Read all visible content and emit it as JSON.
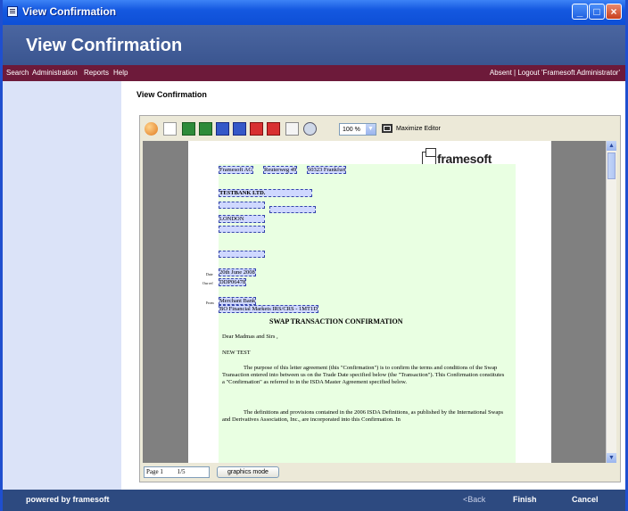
{
  "window": {
    "title": "View Confirmation"
  },
  "header": {
    "title": "View Confirmation"
  },
  "menu": {
    "items": [
      "Search",
      "Administration",
      "Reports",
      "Help"
    ],
    "right": "Absent | Logout 'Framesoft Administrator'"
  },
  "page": {
    "title": "View Confirmation"
  },
  "toolbar": {
    "icons": [
      "users-icon",
      "copy-icon",
      "excel-icon",
      "excel-export-icon",
      "word-icon",
      "word-export-icon",
      "pdf-icon",
      "pdf-export-icon",
      "document-icon",
      "link-icon"
    ],
    "zoom": "100 %",
    "maximize_label": "Maximize Editor"
  },
  "document": {
    "logo": "framesoft",
    "address": [
      "Framesoft AG",
      "Reuterweg 49",
      "60323 Frankfurt"
    ],
    "recipient_name": "TESTBANK LTD.",
    "recipient_city": "LONDON",
    "date_label": "Date",
    "date": "20th June 2008",
    "ourref_label": "Our ref",
    "ourref": "DDP06478",
    "from_label": "From",
    "from_line1": "Merchant Bank",
    "from_line2": "BO Financial Markets IRS/CRS - 1MT1D",
    "heading": "SWAP TRANSACTION CONFIRMATION",
    "salutation": "Dear Madmas and Sirs ,",
    "subject": "NEW TEST",
    "para1": "The purpose of this letter agreement (this \"Confirmation\") is to confirm the  terms and conditions of the Swap Transaction entered into between us on the Trade Date specified below (the \"Transaction\"). This Confirmation constitutes a \"Confirmation\" as referred to in the ISDA Master Agreement specified below.",
    "para2": "The definitions and provisions contained in the 2006 ISDA Definitions, as published by the International Swaps and Derivatives Association, Inc., are incorporated into this Confirmation. In"
  },
  "status": {
    "page_label": "Page 1",
    "page_count": "1/5",
    "graphics_mode": "graphics mode"
  },
  "footer": {
    "powered": "powered by framesoft",
    "back": "<Back",
    "finish": "Finish",
    "cancel": "Cancel"
  },
  "colors": {
    "menubar": "#6d1a3a",
    "header": "#4460a0",
    "leftpanel": "#dbe3f8",
    "doc_field": "#e9ffe2"
  }
}
